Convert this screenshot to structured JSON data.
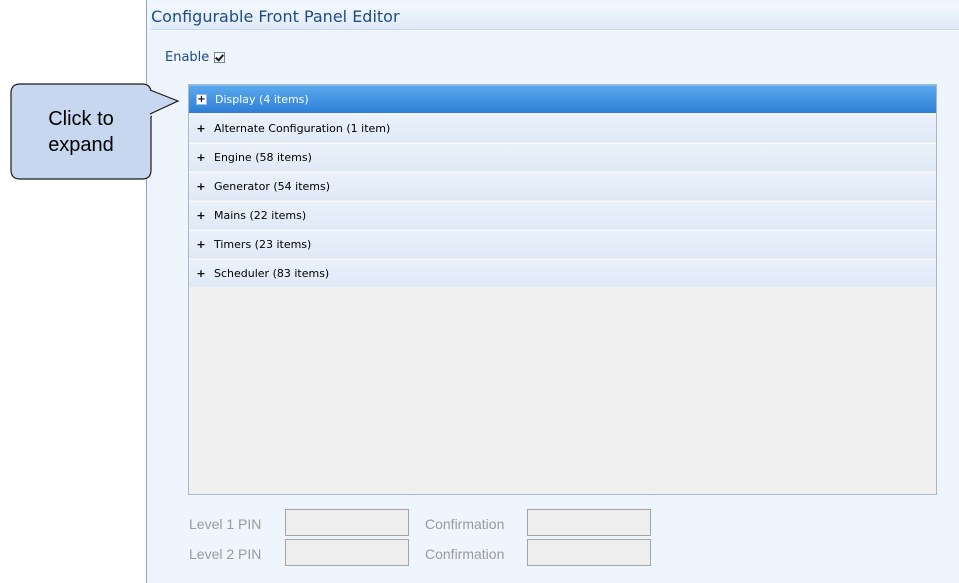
{
  "window": {
    "title": "Configurable Front Panel Editor"
  },
  "enable": {
    "label": "Enable",
    "checked": true
  },
  "tree": {
    "items": [
      {
        "expander": "+",
        "label": "Display (4 items)",
        "selected": true
      },
      {
        "expander": "+",
        "label": "Alternate Configuration (1 item)",
        "selected": false
      },
      {
        "expander": "+",
        "label": "Engine (58 items)",
        "selected": false
      },
      {
        "expander": "+",
        "label": "Generator (54 items)",
        "selected": false
      },
      {
        "expander": "+",
        "label": "Mains (22 items)",
        "selected": false
      },
      {
        "expander": "+",
        "label": "Timers (23 items)",
        "selected": false
      },
      {
        "expander": "+",
        "label": "Scheduler (83 items)",
        "selected": false
      }
    ]
  },
  "pins": {
    "level1_label": "Level 1 PIN",
    "level1_value": "",
    "level1_confirm_label": "Confirmation",
    "level1_confirm_value": "",
    "level2_label": "Level 2 PIN",
    "level2_value": "",
    "level2_confirm_label": "Confirmation",
    "level2_confirm_value": ""
  },
  "callout": {
    "line1": "Click to",
    "line2": "expand"
  },
  "colors": {
    "title_text": "#1f4c86",
    "selection": "#2d7fd6",
    "window_bg": "#eef5fc",
    "callout_fill": "#c7d7ef",
    "disabled_text": "#9a9a9a"
  }
}
